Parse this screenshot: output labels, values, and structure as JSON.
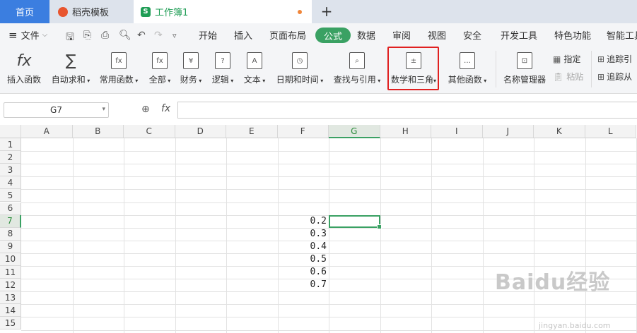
{
  "tabs": {
    "home": "首页",
    "template": "稻壳模板",
    "workbook": "工作簿1",
    "workbook_icon": "S",
    "new_tab": "+"
  },
  "menu": {
    "file": "文件",
    "items": [
      "开始",
      "插入",
      "页面布局",
      "公式",
      "数据",
      "审阅",
      "视图",
      "安全",
      "开发工具",
      "特色功能",
      "智能工具"
    ],
    "active": "公式"
  },
  "ribbon": {
    "insert_function": "插入函数",
    "autosum": "自动求和",
    "common": "常用函数",
    "all": "全部",
    "finance": "财务",
    "logic": "逻辑",
    "text": "文本",
    "datetime": "日期和时间",
    "lookup": "查找与引用",
    "math": "数学和三角",
    "other": "其他函数",
    "name_manager": "名称管理器",
    "specify": "指定",
    "paste": "粘贴",
    "trace_precedents": "追踪引",
    "trace_dependents": "追踪从"
  },
  "formula_bar": {
    "name_box": "G7",
    "fx": "fx",
    "value": ""
  },
  "columns": [
    "A",
    "B",
    "C",
    "D",
    "E",
    "F",
    "G",
    "H",
    "I",
    "J",
    "K",
    "L"
  ],
  "rows": [
    "1",
    "2",
    "3",
    "4",
    "5",
    "6",
    "7",
    "8",
    "9",
    "10",
    "11",
    "12",
    "13",
    "14",
    "15"
  ],
  "selected_col": "G",
  "selected_row": "7",
  "cells_f": [
    "0.2",
    "0.3",
    "0.4",
    "0.5",
    "0.6",
    "0.7"
  ],
  "watermark": "Baidu经验",
  "watermark_url": "jingyan.baidu.com",
  "colors": {
    "accent": "#3aa163",
    "home_tab": "#3b7ee0",
    "highlight": "#e02020"
  }
}
